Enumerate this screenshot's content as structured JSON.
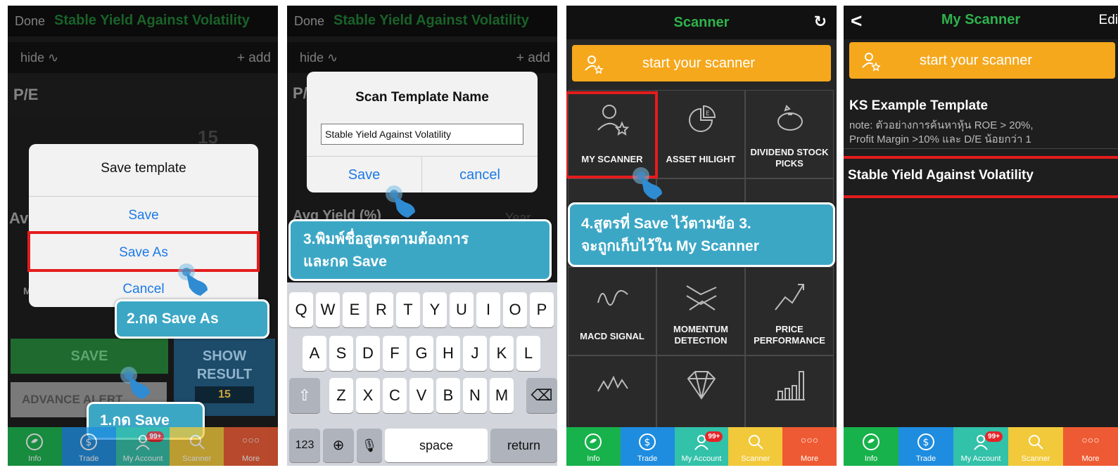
{
  "screens": [
    {
      "topbar": {
        "done": "Done",
        "title": "Stable Yield Against Volatility"
      },
      "subbar": {
        "hide": "hide",
        "add": "+ add"
      },
      "pe_label": "P/E",
      "pe_value": "15",
      "avg_label_partial": "Av",
      "m_label_partial": "M",
      "dialog": {
        "title": "Save template",
        "save": "Save",
        "save_as": "Save As",
        "cancel": "Cancel"
      },
      "buttons": {
        "save": "SAVE",
        "show_result": "SHOW RESULT",
        "result_count": "15",
        "advance_alert": "ADVANCE ALERT"
      },
      "callouts": {
        "step2": "2.กด Save As",
        "step1": "1.กด Save"
      }
    },
    {
      "topbar": {
        "done": "Done",
        "title": "Stable Yield Against Volatility"
      },
      "subbar": {
        "hide": "hide",
        "add": "+ add"
      },
      "pe_partial": "P/",
      "dialog": {
        "title": "Scan Template Name",
        "input_value": "Stable Yield Against Volatility",
        "save": "Save",
        "cancel": "cancel"
      },
      "avg_yield_label": "Avg Yield (%)",
      "year_label": "Year",
      "callout_step3_line1": "3.พิมพ์ชื่อสูตรตามต้องการ",
      "callout_step3_line2": "และกด Save",
      "keyboard": {
        "row1": [
          "Q",
          "W",
          "E",
          "R",
          "T",
          "Y",
          "U",
          "I",
          "O",
          "P"
        ],
        "row2": [
          "A",
          "S",
          "D",
          "F",
          "G",
          "H",
          "J",
          "K",
          "L"
        ],
        "row3": [
          "Z",
          "X",
          "C",
          "V",
          "B",
          "N",
          "M"
        ],
        "numbers": "123",
        "space": "space",
        "return": "return"
      }
    },
    {
      "header": {
        "title": "Scanner"
      },
      "start_bar": "start your scanner",
      "grid": [
        {
          "label": "MY SCANNER"
        },
        {
          "label": "ASSET HILIGHT"
        },
        {
          "label": "DIVIDEND STOCK PICKS"
        },
        {
          "label": "MACD SIGNAL"
        },
        {
          "label": "MOMENTUM DETECTION"
        },
        {
          "label": "PRICE PERFORMANCE"
        }
      ],
      "callout_step4_line1": "4.สูตรที่ Save ไว้ตามข้อ 3.",
      "callout_step4_line2": "จะถูกเก็บไว้ใน My Scanner"
    },
    {
      "header": {
        "back": "<",
        "title": "My Scanner",
        "edit": "Edi"
      },
      "start_bar": "start your scanner",
      "templates": [
        {
          "name": "KS Example Template",
          "note_line1": "note: ตัวอย่างการค้นหาหุ้น ROE > 20%,",
          "note_line2": "Profit Margin >10% และ D/E น้อยกว่า 1"
        },
        {
          "name": "Stable Yield Against Volatility"
        }
      ]
    }
  ],
  "tabbar": [
    {
      "label": "Info"
    },
    {
      "label": "Trade"
    },
    {
      "label": "My Account",
      "badge": "99+"
    },
    {
      "label": "Scanner"
    },
    {
      "label": "More"
    }
  ],
  "colors": {
    "green_title": "#2fb24c",
    "ios_blue": "#1c7ae6",
    "highlight_red": "#e41c1c",
    "callout_blue": "#3ca7c5",
    "orange": "#f5a81c"
  }
}
